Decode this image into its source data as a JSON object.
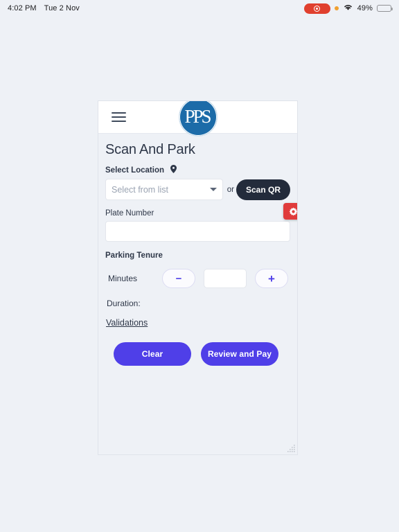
{
  "statusbar": {
    "time": "4:02 PM",
    "date": "Tue 2 Nov",
    "battery_percent": "49%",
    "recording_icon": "record-icon",
    "orange_dot_icon": "privacy-indicator-icon",
    "wifi_icon": "wifi-icon",
    "battery_icon": "battery-icon"
  },
  "app": {
    "menu_icon": "hamburger-menu-icon",
    "logo_text": "PPS",
    "logo_color": "#1c6ba8"
  },
  "main": {
    "title": "Scan And Park",
    "location": {
      "label": "Select Location",
      "pin_icon": "location-pin-icon",
      "placeholder": "Select from list",
      "value": "",
      "caret_icon": "chevron-down-icon",
      "or_text": "or",
      "scan_qr_label": "Scan QR"
    },
    "plate": {
      "label": "Plate Number",
      "value": "",
      "placeholder": ""
    },
    "settings_fab": {
      "icon": "gear-icon",
      "color": "#e03b3b"
    },
    "tenure": {
      "label": "Parking Tenure",
      "unit_label": "Minutes",
      "decrement_label": "−",
      "increment_label": "+",
      "value": "",
      "accent_color": "#4f3fe8"
    },
    "duration": {
      "label": "Duration:",
      "value": ""
    },
    "validations_link": "Validations",
    "actions": {
      "clear_label": "Clear",
      "review_label": "Review and Pay"
    }
  }
}
